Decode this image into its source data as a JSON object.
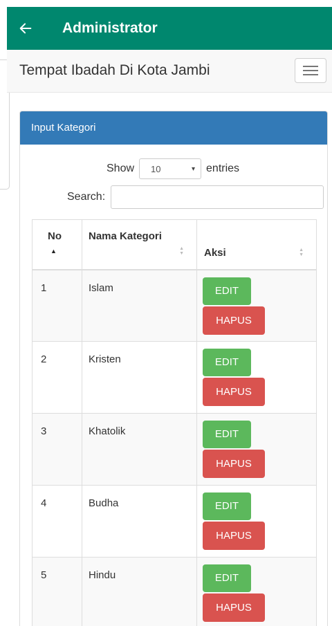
{
  "appbar": {
    "title": "Administrator",
    "back_icon": "arrow-left-icon",
    "color": "#00876e"
  },
  "navbar": {
    "brand": "Tempat Ibadah Di Kota Jambi",
    "toggle_icon": "hamburger-menu-icon"
  },
  "panel": {
    "heading": "Input Kategori",
    "heading_color": "#337ab7",
    "length": {
      "show_label": "Show",
      "selected": "10",
      "entries_label": "entries"
    },
    "search": {
      "label": "Search:",
      "value": ""
    },
    "table": {
      "columns": [
        "No",
        "Nama Kategori",
        "Aksi"
      ],
      "sorted_column": "No",
      "sort_direction": "asc",
      "rows": [
        {
          "no": "1",
          "nama": "Islam",
          "edit": "EDIT",
          "hapus": "HAPUS"
        },
        {
          "no": "2",
          "nama": "Kristen",
          "edit": "EDIT",
          "hapus": "HAPUS"
        },
        {
          "no": "3",
          "nama": "Khatolik",
          "edit": "EDIT",
          "hapus": "HAPUS"
        },
        {
          "no": "4",
          "nama": "Budha",
          "edit": "EDIT",
          "hapus": "HAPUS"
        },
        {
          "no": "5",
          "nama": "Hindu",
          "edit": "EDIT",
          "hapus": "HAPUS"
        }
      ]
    },
    "button_colors": {
      "edit": "#5cb85c",
      "hapus": "#d9534f"
    }
  }
}
